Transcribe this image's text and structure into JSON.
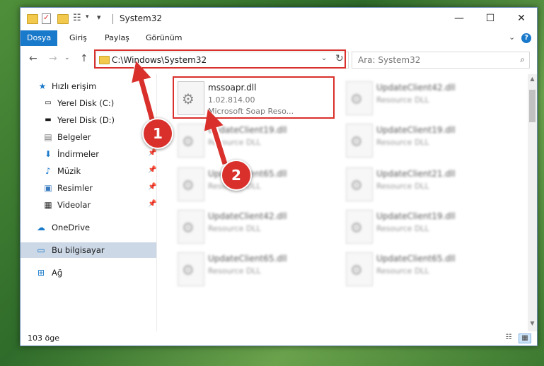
{
  "window": {
    "title": "System32",
    "minimize_icon": "minimize-icon",
    "maximize_icon": "maximize-icon",
    "close_icon": "close-icon"
  },
  "ribbon": {
    "tabs": [
      {
        "label": "Dosya",
        "active": true
      },
      {
        "label": "Giriş",
        "active": false
      },
      {
        "label": "Paylaş",
        "active": false
      },
      {
        "label": "Görünüm",
        "active": false
      }
    ],
    "help_label": "?"
  },
  "nav": {
    "address": "C:\\Windows\\System32",
    "search_placeholder": "Ara: System32"
  },
  "sidebar": {
    "items": [
      {
        "label": "Hızlı erişim",
        "icon": "star-icon"
      },
      {
        "label": "Yerel Disk (C:)",
        "icon": "drive-icon"
      },
      {
        "label": "Yerel Disk (D:)",
        "icon": "drive-icon"
      },
      {
        "label": "Belgeler",
        "icon": "documents-icon"
      },
      {
        "label": "İndirmeler",
        "icon": "download-icon"
      },
      {
        "label": "Müzik",
        "icon": "music-icon"
      },
      {
        "label": "Resimler",
        "icon": "pictures-icon"
      },
      {
        "label": "Videolar",
        "icon": "videos-icon"
      },
      {
        "label": "OneDrive",
        "icon": "cloud-icon"
      },
      {
        "label": "Bu bilgisayar",
        "icon": "computer-icon"
      },
      {
        "label": "Ağ",
        "icon": "network-icon"
      }
    ]
  },
  "files": [
    {
      "name": "mssoapr.dll",
      "version": "1.02.814.00",
      "desc": "Microsoft Soap Reso..."
    },
    {
      "name": "UpdateClient42.dll",
      "desc": "Resource DLL"
    },
    {
      "name": "UpdateClient19.dll",
      "desc": "Resource DLL"
    },
    {
      "name": "UpdateClient19.dll",
      "desc": "Resource DLL"
    },
    {
      "name": "UpdateClient65.dll",
      "desc": "Resource DLL"
    },
    {
      "name": "UpdateClient21.dll",
      "desc": "Resource DLL"
    },
    {
      "name": "UpdateClient42.dll",
      "desc": "Resource DLL"
    },
    {
      "name": "UpdateClient19.dll",
      "desc": "Resource DLL"
    },
    {
      "name": "UpdateClient65.dll",
      "desc": "Resource DLL"
    },
    {
      "name": "UpdateClient65.dll",
      "desc": "Resource DLL"
    }
  ],
  "status": {
    "item_count": "103 öge"
  },
  "annotations": {
    "badge1": "1",
    "badge2": "2",
    "accent": "#d9302c"
  }
}
